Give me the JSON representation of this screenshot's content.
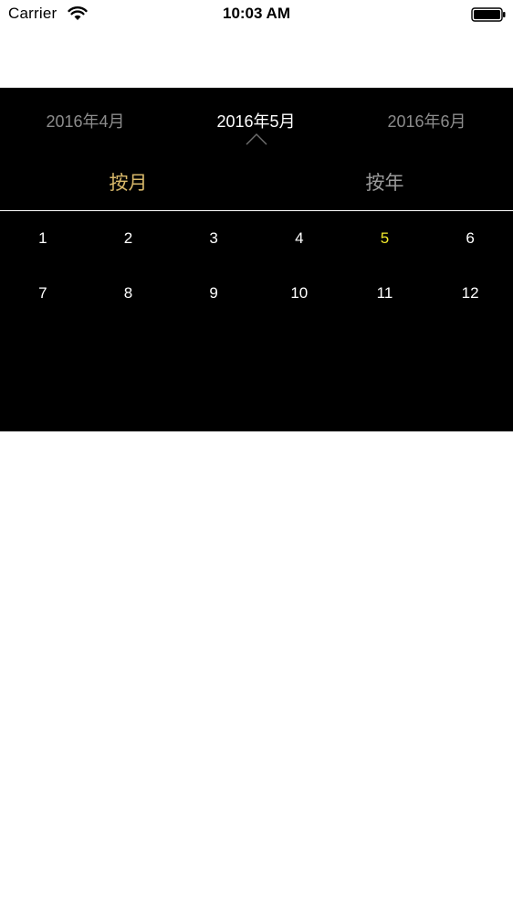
{
  "status_bar": {
    "carrier": "Carrier",
    "time": "10:03 AM",
    "icons": [
      "wifi-icon",
      "battery-icon"
    ]
  },
  "picker": {
    "months": {
      "prev": "2016年4月",
      "current": "2016年5月",
      "next": "2016年6月"
    },
    "modes": {
      "by_month": "按月",
      "by_year": "按年",
      "selected": "by_month"
    },
    "items": [
      "1",
      "2",
      "3",
      "4",
      "5",
      "6",
      "7",
      "8",
      "9",
      "10",
      "11",
      "12"
    ],
    "selected_item": "5"
  },
  "colors": {
    "panel_background": "#000000",
    "selected_mode": "#d8b86a",
    "selected_item": "#f2ea2c",
    "inactive_text": "#8c8c8c",
    "active_text": "#ffffff"
  }
}
